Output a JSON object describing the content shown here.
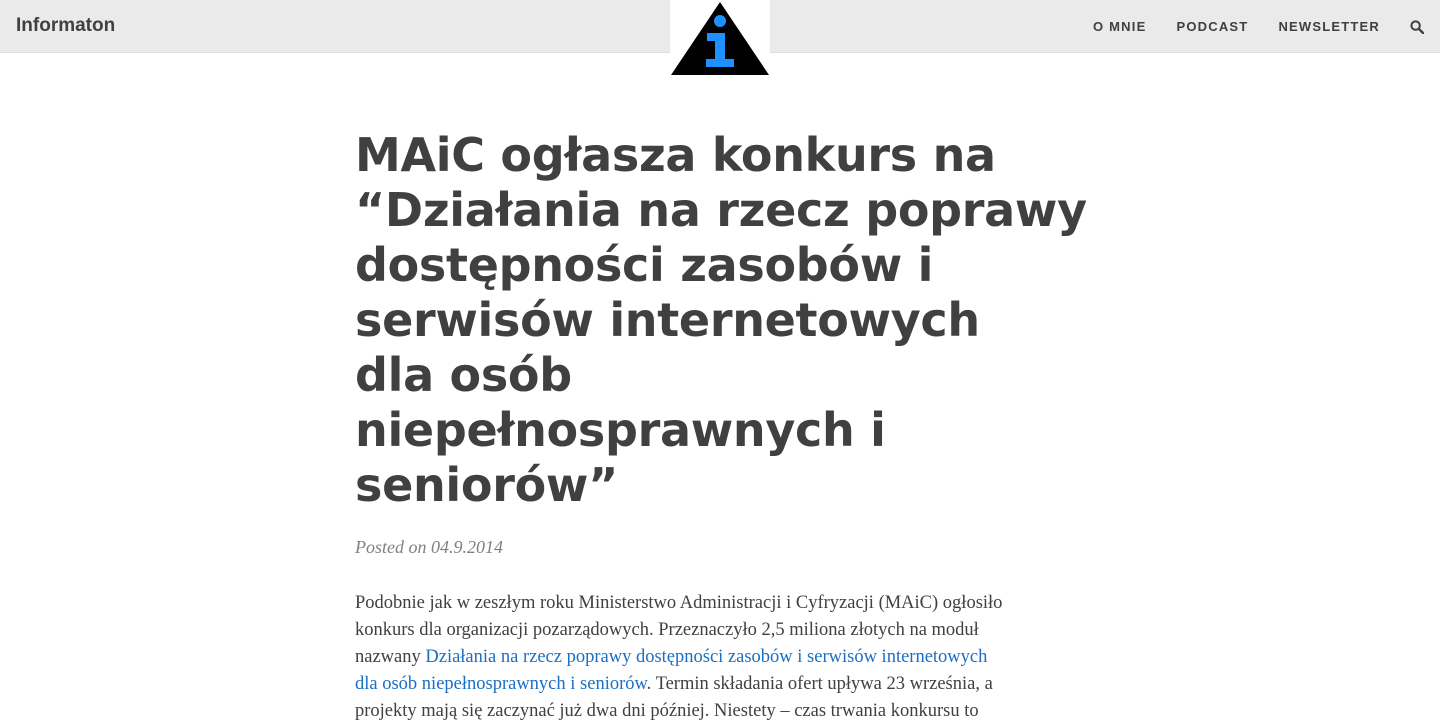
{
  "header": {
    "brand": "Informaton",
    "logo": {
      "icon": "info-triangle-logo",
      "colors": {
        "triangle": "#000000",
        "letter": "#1e90ff"
      }
    },
    "nav": [
      {
        "label": "O MNIE"
      },
      {
        "label": "PODCAST"
      },
      {
        "label": "NEWSLETTER"
      }
    ],
    "search_icon": "search-icon"
  },
  "post": {
    "title_lines": [
      "MAiC ogłasza konkurs na",
      "“Działania na rzecz poprawy",
      "dostępności zasobów i",
      "serwisów internetowych",
      "dla osób",
      "niepełnosprawnych i",
      "seniorów”"
    ],
    "meta_prefix": "Posted on",
    "date": "04.9.2014",
    "body": {
      "line1": "Podobnie jak w zeszłym roku Ministerstwo Administracji i Cyfryzacji (MAiC) ogłosiło",
      "line2": "konkurs dla organizacji pozarządowych. Przeznaczyło 2,5 miliona złotych na moduł",
      "line3_prefix": "nazwany ",
      "link_line1": "Działania na rzecz poprawy dostępności zasobów i serwisów internetowych",
      "link_line2": "dla osób niepełnosprawnych i seniorów",
      "after_link": ". Termin składania ofert upływa 23 września, a",
      "line5": "projekty mają się zaczynać już dwa dni później. Niestety – czas trwania konkursu to"
    }
  },
  "colors": {
    "link": "#1a6fc4",
    "navbar_bg": "#eaeaea",
    "text": "#404040"
  }
}
